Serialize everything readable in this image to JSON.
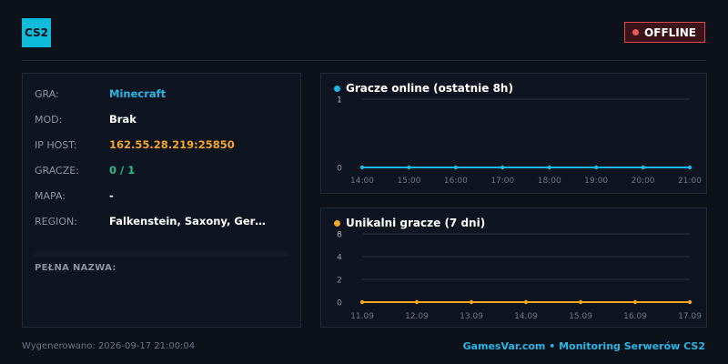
{
  "header": {
    "logo_text": "CS2",
    "status_label": "OFFLINE",
    "status_color": "#e0484f"
  },
  "info": {
    "rows": [
      {
        "key": "GRA:",
        "value": "Minecraft"
      },
      {
        "key": "MOD:",
        "value": "Brak"
      },
      {
        "key": "IP HOST:",
        "value": "162.55.28.219:25850"
      },
      {
        "key": "GRACZE:",
        "value": "0 / 1"
      },
      {
        "key": "MAPA:",
        "value": "-"
      },
      {
        "key": "REGION:",
        "value": "Falkenstein, Saxony, Ger…"
      }
    ],
    "full_name_label": "PEŁNA NAZWA:"
  },
  "charts": {
    "online": {
      "title": "Gracze online (ostatnie 8h)",
      "color": "#1fb5e0"
    },
    "unique": {
      "title": "Unikalni gracze (7 dni)",
      "color": "#f5a623"
    }
  },
  "chart_data": [
    {
      "type": "line",
      "title": "Gracze online (ostatnie 8h)",
      "x": [
        "14:00",
        "15:00",
        "16:00",
        "17:00",
        "18:00",
        "19:00",
        "20:00",
        "21:00"
      ],
      "series": [
        {
          "values": [
            0,
            0,
            0,
            0,
            0,
            0,
            0,
            0
          ]
        }
      ],
      "yticks": [
        "0",
        "1",
        "1",
        "1"
      ],
      "ylim": [
        0,
        1
      ],
      "grid": true,
      "color": "#1fb5e0"
    },
    {
      "type": "line",
      "title": "Unikalni gracze (7 dni)",
      "x": [
        "11.09",
        "12.09",
        "13.09",
        "14.09",
        "15.09",
        "16.09",
        "17.09"
      ],
      "series": [
        {
          "values": [
            0,
            0,
            0,
            0,
            0,
            0,
            0
          ]
        }
      ],
      "yticks": [
        "0",
        "2",
        "4",
        "6",
        "8"
      ],
      "ylim": [
        0,
        6
      ],
      "grid": true,
      "color": "#f5a623"
    }
  ],
  "footer": {
    "generated": "Wygenerowano: 2026-09-17 21:00:04",
    "brand": "GamesVar.com • Monitoring Serwerów CS2"
  }
}
